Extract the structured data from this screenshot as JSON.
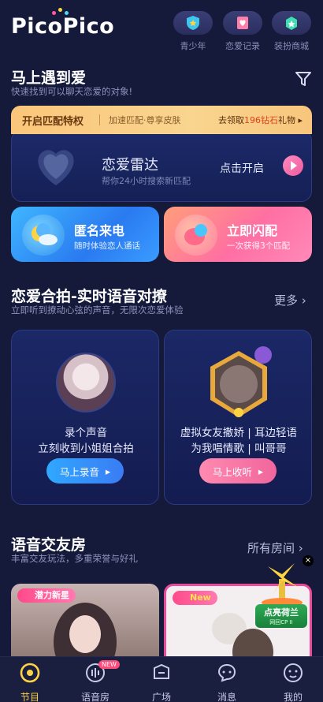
{
  "app": {
    "logo": "PicoPico"
  },
  "top_actions": [
    {
      "label": "青少年",
      "icon": "shield-icon"
    },
    {
      "label": "恋爱记录",
      "icon": "love-record-icon"
    },
    {
      "label": "装扮商城",
      "icon": "dress-shop-icon"
    }
  ],
  "meet": {
    "title": "马上遇到爱",
    "subtitle": "快速找到可以聊天恋爱的对象!",
    "filter_icon": "filter-icon"
  },
  "privilege": {
    "title": "开启匹配特权",
    "perks": "加速匹配·尊享皮肤",
    "claim_prefix": "去领取",
    "claim_highlight": "196钻石",
    "claim_suffix": "礼物",
    "arrow": "▸"
  },
  "radar": {
    "title": "恋爱雷达",
    "subtitle": "帮你24小时搜索新匹配",
    "action": "点击开启"
  },
  "anon_call": {
    "title": "匿名来电",
    "subtitle": "随时体验恋人通话"
  },
  "flash_match": {
    "title": "立即闪配",
    "subtitle": "一次获得3个匹配"
  },
  "duet": {
    "title": "恋爱合拍-实时语音对撩",
    "subtitle": "立即听到撩动心弦的声音，无限次恋爱体验",
    "more": "更多",
    "cards": [
      {
        "line1": "录个声音",
        "line2": "立刻收到小姐姐合拍",
        "button": "马上录音"
      },
      {
        "line1": "虚拟女友撒娇 | 耳边轻语",
        "line2": "为我唱情歌 | 叫哥哥",
        "button": "马上收听"
      }
    ]
  },
  "voice_rooms": {
    "title": "语音交友房",
    "subtitle": "丰富交友玩法，多重荣誉与好礼",
    "all": "所有房间",
    "rooms": [
      {
        "tag": "潜力新星"
      },
      {
        "tag": "New"
      }
    ]
  },
  "promo": {
    "title": "点亮荷兰",
    "sub": "网回CP II",
    "close": "×"
  },
  "nav": {
    "items": [
      {
        "label": "节目",
        "active": true
      },
      {
        "label": "语音房",
        "badge": "NEW"
      },
      {
        "label": "广场"
      },
      {
        "label": "消息"
      },
      {
        "label": "我的"
      }
    ]
  },
  "colors": {
    "accent": "#ffd443",
    "bg": "#151a3b",
    "pink": "#f05a9c"
  }
}
